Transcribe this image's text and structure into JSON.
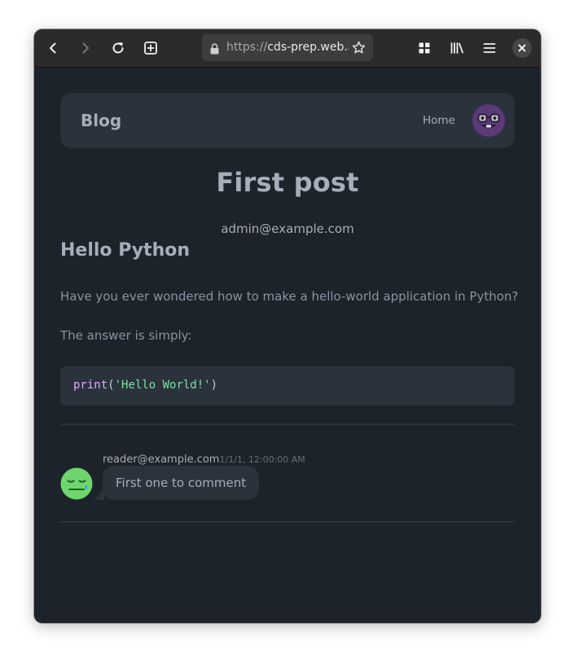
{
  "browser": {
    "url_scheme": "https://",
    "url_host": "cds-prep.web.a",
    "icons": {
      "back": "chevron-left-icon",
      "forward": "chevron-right-icon",
      "reload": "reload-icon",
      "new_tab": "plus-square-icon",
      "lock": "lock-icon",
      "bookmark": "star-icon",
      "extensions": "grid-icon",
      "library": "library-icon",
      "menu": "hamburger-menu-icon",
      "close": "close-icon"
    }
  },
  "navbar": {
    "brand": "Blog",
    "home_link": "Home",
    "avatar": "nerd-face-avatar"
  },
  "post": {
    "title": "First post",
    "author": "admin@example.com",
    "heading": "Hello Python",
    "paragraph_1": "Have you ever wondered how to make a hello-world application in Python?",
    "paragraph_2": "The answer is simply:",
    "code": {
      "function": "print",
      "open_paren": "(",
      "string": "'Hello World!'",
      "close_paren": ")"
    }
  },
  "comments": [
    {
      "author": "reader@example.com",
      "time": "1/1/1, 12:00:00 AM",
      "text": "First one to comment",
      "avatar": "smiling-face-with-tear-avatar"
    }
  ],
  "colors": {
    "page_bg": "#1d232a",
    "surface": "#2a323c",
    "text": "#a6adbb",
    "code_function": "#e1aeff",
    "code_string": "#7ee0a4"
  }
}
